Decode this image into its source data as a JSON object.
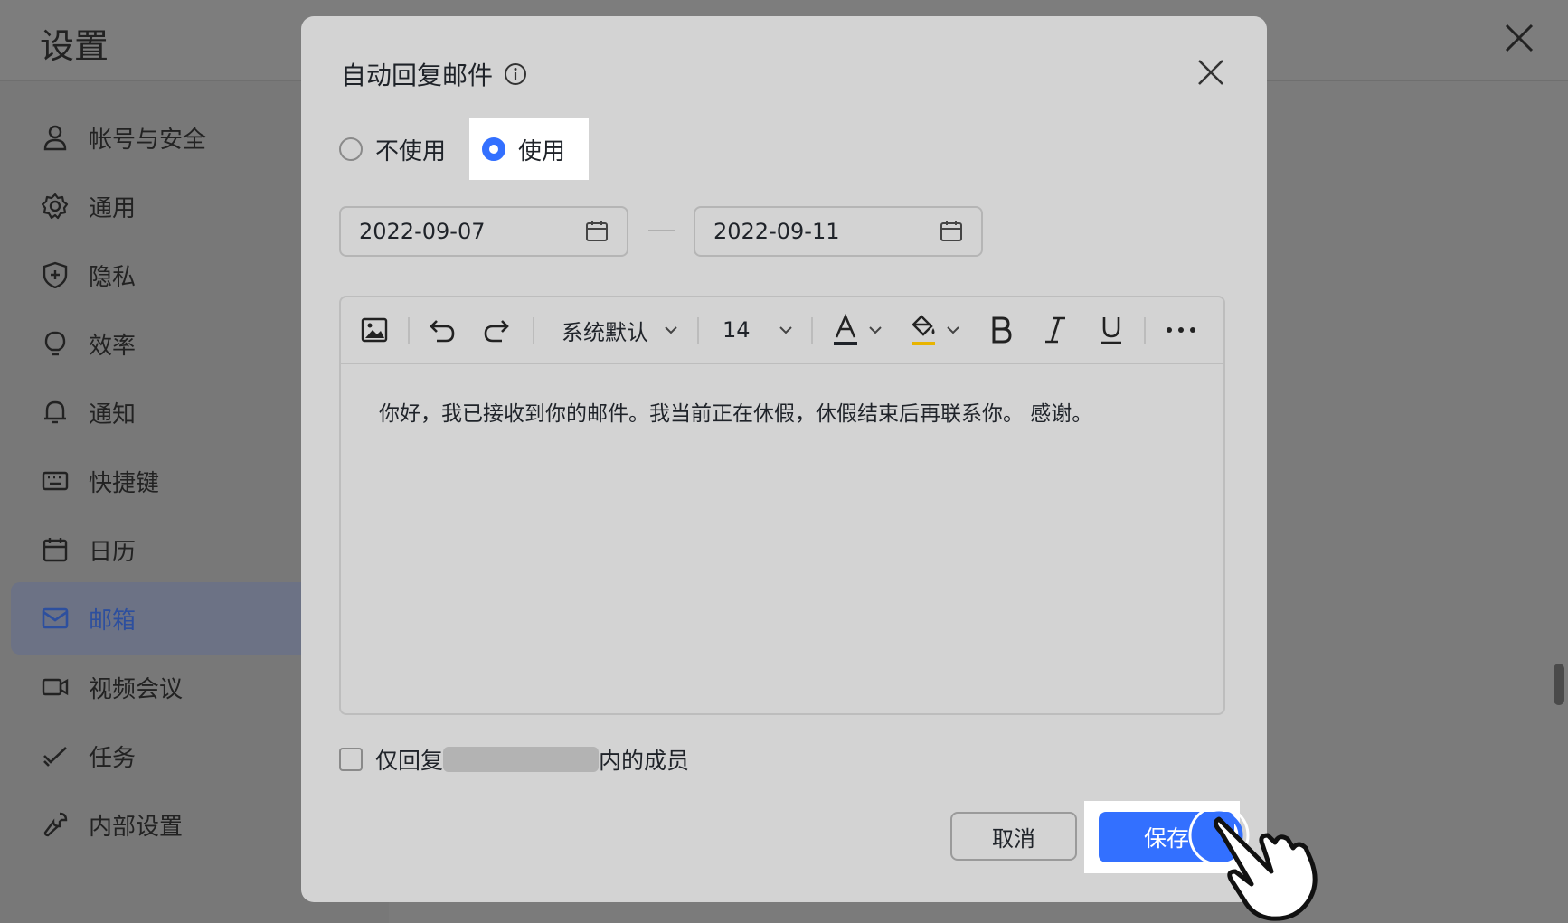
{
  "settings": {
    "title": "设置",
    "nav": [
      {
        "label": "帐号与安全",
        "icon": "user-icon"
      },
      {
        "label": "通用",
        "icon": "gear-icon"
      },
      {
        "label": "隐私",
        "icon": "shield-icon"
      },
      {
        "label": "效率",
        "icon": "lightbulb-icon"
      },
      {
        "label": "通知",
        "icon": "bell-icon"
      },
      {
        "label": "快捷键",
        "icon": "keyboard-icon"
      },
      {
        "label": "日历",
        "icon": "calendar-icon"
      },
      {
        "label": "邮箱",
        "icon": "mail-icon",
        "active": true
      },
      {
        "label": "视频会议",
        "icon": "video-icon"
      },
      {
        "label": "任务",
        "icon": "check-icon"
      },
      {
        "label": "内部设置",
        "icon": "wrench-icon"
      }
    ]
  },
  "dialog": {
    "title": "自动回复邮件",
    "radio": {
      "off_label": "不使用",
      "on_label": "使用",
      "selected": "on"
    },
    "start_date": "2022-09-07",
    "end_date": "2022-09-11",
    "toolbar": {
      "font": "系统默认",
      "size": "14",
      "text_color": "#1f2329",
      "highlight_color": "#e8b400"
    },
    "body_text": "你好，我已接收到你的邮件。我当前正在休假，休假结束后再联系你。 感谢。",
    "only_reply": {
      "prefix": "仅回复",
      "suffix": "内的成员",
      "checked": false
    },
    "cancel_label": "取消",
    "save_label": "保存"
  },
  "colors": {
    "accent": "#3370ff",
    "overlay": "#7b7b7b",
    "dialog_bg": "#d3d3d3"
  }
}
